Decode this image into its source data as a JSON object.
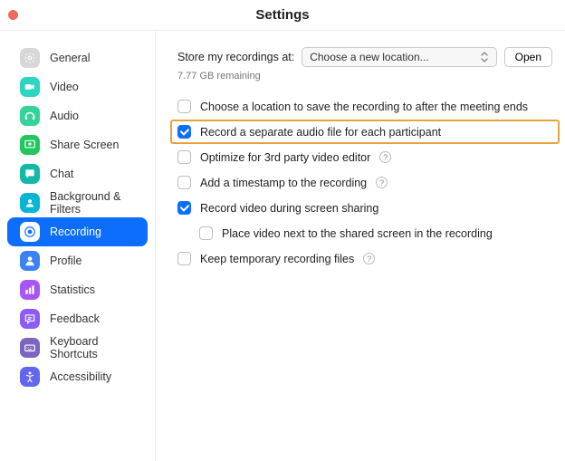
{
  "title": "Settings",
  "sidebar": {
    "items": [
      {
        "label": "General",
        "icon_bg": "#d7d7d7",
        "icon_name": "gear-icon"
      },
      {
        "label": "Video",
        "icon_bg": "#2dd4bf",
        "icon_name": "video-icon"
      },
      {
        "label": "Audio",
        "icon_bg": "#34d399",
        "icon_name": "audio-icon"
      },
      {
        "label": "Share Screen",
        "icon_bg": "#22c55e",
        "icon_name": "share-screen-icon"
      },
      {
        "label": "Chat",
        "icon_bg": "#14b8a6",
        "icon_name": "chat-icon"
      },
      {
        "label": "Background & Filters",
        "icon_bg": "#06b6d4",
        "icon_name": "background-filters-icon"
      },
      {
        "label": "Recording",
        "icon_bg": "#ffffff",
        "icon_name": "recording-icon",
        "active": true
      },
      {
        "label": "Profile",
        "icon_bg": "#3b82f6",
        "icon_name": "profile-icon"
      },
      {
        "label": "Statistics",
        "icon_bg": "#a855f7",
        "icon_name": "statistics-icon"
      },
      {
        "label": "Feedback",
        "icon_bg": "#8b5cf6",
        "icon_name": "feedback-icon"
      },
      {
        "label": "Keyboard Shortcuts",
        "icon_bg": "#7c65c1",
        "icon_name": "keyboard-icon"
      },
      {
        "label": "Accessibility",
        "icon_bg": "#6366f1",
        "icon_name": "accessibility-icon"
      }
    ]
  },
  "main": {
    "store_label": "Store my recordings at:",
    "location_select": "Choose a new location...",
    "open_btn": "Open",
    "remaining": "7.77 GB remaining",
    "options": [
      {
        "label": "Choose a location to save the recording to after the meeting ends",
        "checked": false
      },
      {
        "label": "Record a separate audio file for each participant",
        "checked": true,
        "highlighted": true
      },
      {
        "label": "Optimize for 3rd party video editor",
        "checked": false,
        "help": true
      },
      {
        "label": "Add a timestamp to the recording",
        "checked": false,
        "help": true
      },
      {
        "label": "Record video during screen sharing",
        "checked": true
      },
      {
        "label": "Place video next to the shared screen in the recording",
        "checked": false,
        "sub": true
      },
      {
        "label": "Keep temporary recording files",
        "checked": false,
        "help": true
      }
    ],
    "help_char": "?"
  }
}
